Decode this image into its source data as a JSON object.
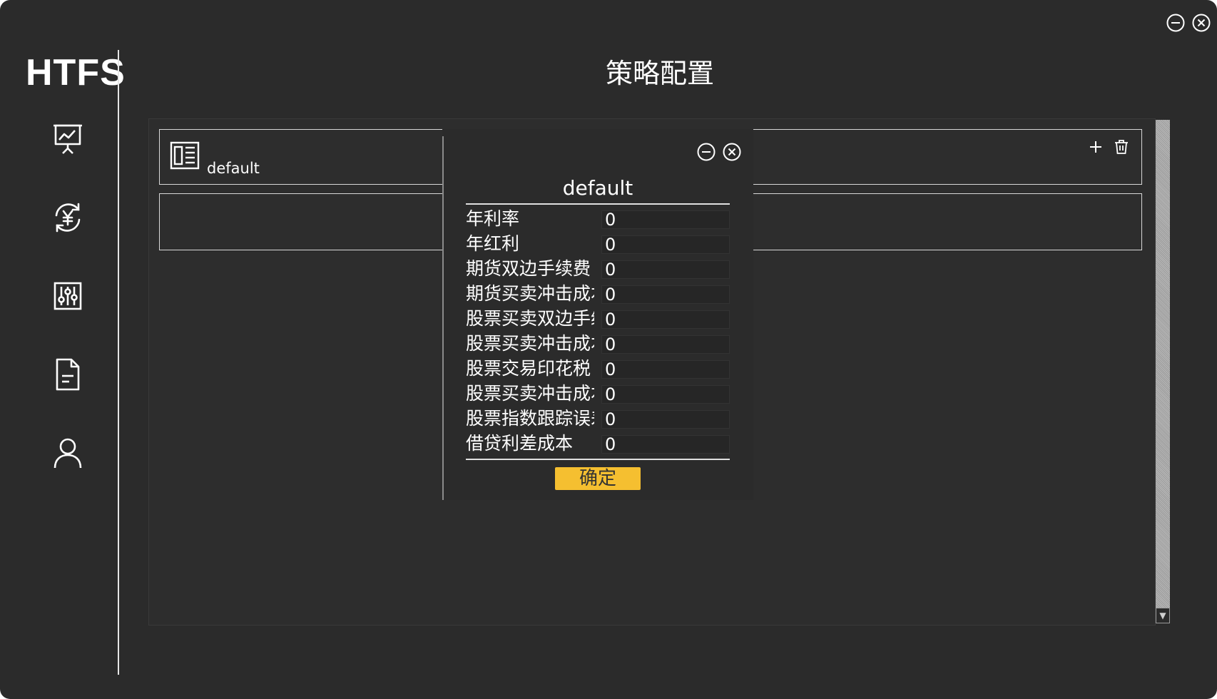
{
  "app": {
    "logo": "HTFS",
    "title": "策略配置"
  },
  "window_controls": [
    "minimize-icon",
    "close-icon"
  ],
  "sidebar": {
    "items": [
      {
        "name": "dashboard",
        "icon": "chart-presentation-icon"
      },
      {
        "name": "exchange",
        "icon": "yen-exchange-icon"
      },
      {
        "name": "settings",
        "icon": "sliders-icon"
      },
      {
        "name": "document",
        "icon": "document-icon"
      },
      {
        "name": "user",
        "icon": "user-icon"
      }
    ]
  },
  "strategy_list": {
    "items": [
      {
        "name": "default",
        "icon": "strategy-card-icon"
      }
    ],
    "add_icon": "plus-icon",
    "delete_icon": "trash-icon"
  },
  "dialog": {
    "title": "default",
    "fields": [
      {
        "label": "年利率",
        "value": "0"
      },
      {
        "label": "年红利",
        "value": "0"
      },
      {
        "label": "期货双边手续费",
        "value": "0"
      },
      {
        "label": "期货买卖冲击成本",
        "value": "0"
      },
      {
        "label": "股票买卖双边手续费",
        "value": "0"
      },
      {
        "label": "股票买卖冲击成本",
        "value": "0"
      },
      {
        "label": "股票交易印花税",
        "value": "0"
      },
      {
        "label": "股票买卖冲击成本",
        "value": "0"
      },
      {
        "label": "股票指数跟踪误差",
        "value": "0"
      },
      {
        "label": "借贷利差成本",
        "value": "0"
      }
    ],
    "confirm_label": "确定"
  },
  "colors": {
    "background": "#2b2b2b",
    "accent": "#f5bf30",
    "text": "#ffffff",
    "border": "#d8d8d8"
  }
}
